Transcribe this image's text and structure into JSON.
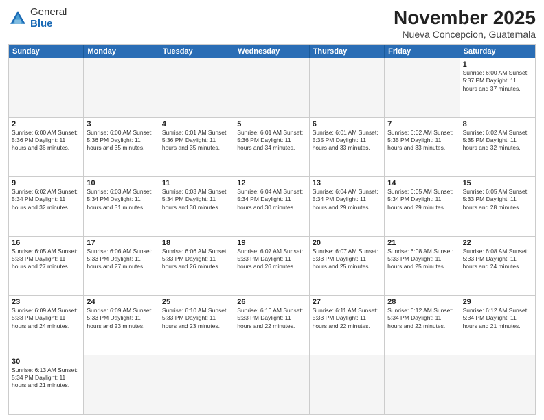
{
  "header": {
    "logo": {
      "general": "General",
      "blue": "Blue"
    },
    "month_year": "November 2025",
    "location": "Nueva Concepcion, Guatemala"
  },
  "weekdays": [
    "Sunday",
    "Monday",
    "Tuesday",
    "Wednesday",
    "Thursday",
    "Friday",
    "Saturday"
  ],
  "weeks": [
    [
      {
        "day": "",
        "info": "",
        "empty": true
      },
      {
        "day": "",
        "info": "",
        "empty": true
      },
      {
        "day": "",
        "info": "",
        "empty": true
      },
      {
        "day": "",
        "info": "",
        "empty": true
      },
      {
        "day": "",
        "info": "",
        "empty": true
      },
      {
        "day": "",
        "info": "",
        "empty": true
      },
      {
        "day": "1",
        "info": "Sunrise: 6:00 AM\nSunset: 5:37 PM\nDaylight: 11 hours\nand 37 minutes.",
        "empty": false
      }
    ],
    [
      {
        "day": "2",
        "info": "Sunrise: 6:00 AM\nSunset: 5:36 PM\nDaylight: 11 hours\nand 36 minutes.",
        "empty": false
      },
      {
        "day": "3",
        "info": "Sunrise: 6:00 AM\nSunset: 5:36 PM\nDaylight: 11 hours\nand 35 minutes.",
        "empty": false
      },
      {
        "day": "4",
        "info": "Sunrise: 6:01 AM\nSunset: 5:36 PM\nDaylight: 11 hours\nand 35 minutes.",
        "empty": false
      },
      {
        "day": "5",
        "info": "Sunrise: 6:01 AM\nSunset: 5:36 PM\nDaylight: 11 hours\nand 34 minutes.",
        "empty": false
      },
      {
        "day": "6",
        "info": "Sunrise: 6:01 AM\nSunset: 5:35 PM\nDaylight: 11 hours\nand 33 minutes.",
        "empty": false
      },
      {
        "day": "7",
        "info": "Sunrise: 6:02 AM\nSunset: 5:35 PM\nDaylight: 11 hours\nand 33 minutes.",
        "empty": false
      },
      {
        "day": "8",
        "info": "Sunrise: 6:02 AM\nSunset: 5:35 PM\nDaylight: 11 hours\nand 32 minutes.",
        "empty": false
      }
    ],
    [
      {
        "day": "9",
        "info": "Sunrise: 6:02 AM\nSunset: 5:34 PM\nDaylight: 11 hours\nand 32 minutes.",
        "empty": false
      },
      {
        "day": "10",
        "info": "Sunrise: 6:03 AM\nSunset: 5:34 PM\nDaylight: 11 hours\nand 31 minutes.",
        "empty": false
      },
      {
        "day": "11",
        "info": "Sunrise: 6:03 AM\nSunset: 5:34 PM\nDaylight: 11 hours\nand 30 minutes.",
        "empty": false
      },
      {
        "day": "12",
        "info": "Sunrise: 6:04 AM\nSunset: 5:34 PM\nDaylight: 11 hours\nand 30 minutes.",
        "empty": false
      },
      {
        "day": "13",
        "info": "Sunrise: 6:04 AM\nSunset: 5:34 PM\nDaylight: 11 hours\nand 29 minutes.",
        "empty": false
      },
      {
        "day": "14",
        "info": "Sunrise: 6:05 AM\nSunset: 5:34 PM\nDaylight: 11 hours\nand 29 minutes.",
        "empty": false
      },
      {
        "day": "15",
        "info": "Sunrise: 6:05 AM\nSunset: 5:33 PM\nDaylight: 11 hours\nand 28 minutes.",
        "empty": false
      }
    ],
    [
      {
        "day": "16",
        "info": "Sunrise: 6:05 AM\nSunset: 5:33 PM\nDaylight: 11 hours\nand 27 minutes.",
        "empty": false
      },
      {
        "day": "17",
        "info": "Sunrise: 6:06 AM\nSunset: 5:33 PM\nDaylight: 11 hours\nand 27 minutes.",
        "empty": false
      },
      {
        "day": "18",
        "info": "Sunrise: 6:06 AM\nSunset: 5:33 PM\nDaylight: 11 hours\nand 26 minutes.",
        "empty": false
      },
      {
        "day": "19",
        "info": "Sunrise: 6:07 AM\nSunset: 5:33 PM\nDaylight: 11 hours\nand 26 minutes.",
        "empty": false
      },
      {
        "day": "20",
        "info": "Sunrise: 6:07 AM\nSunset: 5:33 PM\nDaylight: 11 hours\nand 25 minutes.",
        "empty": false
      },
      {
        "day": "21",
        "info": "Sunrise: 6:08 AM\nSunset: 5:33 PM\nDaylight: 11 hours\nand 25 minutes.",
        "empty": false
      },
      {
        "day": "22",
        "info": "Sunrise: 6:08 AM\nSunset: 5:33 PM\nDaylight: 11 hours\nand 24 minutes.",
        "empty": false
      }
    ],
    [
      {
        "day": "23",
        "info": "Sunrise: 6:09 AM\nSunset: 5:33 PM\nDaylight: 11 hours\nand 24 minutes.",
        "empty": false
      },
      {
        "day": "24",
        "info": "Sunrise: 6:09 AM\nSunset: 5:33 PM\nDaylight: 11 hours\nand 23 minutes.",
        "empty": false
      },
      {
        "day": "25",
        "info": "Sunrise: 6:10 AM\nSunset: 5:33 PM\nDaylight: 11 hours\nand 23 minutes.",
        "empty": false
      },
      {
        "day": "26",
        "info": "Sunrise: 6:10 AM\nSunset: 5:33 PM\nDaylight: 11 hours\nand 22 minutes.",
        "empty": false
      },
      {
        "day": "27",
        "info": "Sunrise: 6:11 AM\nSunset: 5:33 PM\nDaylight: 11 hours\nand 22 minutes.",
        "empty": false
      },
      {
        "day": "28",
        "info": "Sunrise: 6:12 AM\nSunset: 5:34 PM\nDaylight: 11 hours\nand 22 minutes.",
        "empty": false
      },
      {
        "day": "29",
        "info": "Sunrise: 6:12 AM\nSunset: 5:34 PM\nDaylight: 11 hours\nand 21 minutes.",
        "empty": false
      }
    ],
    [
      {
        "day": "30",
        "info": "Sunrise: 6:13 AM\nSunset: 5:34 PM\nDaylight: 11 hours\nand 21 minutes.",
        "empty": false
      },
      {
        "day": "",
        "info": "",
        "empty": true
      },
      {
        "day": "",
        "info": "",
        "empty": true
      },
      {
        "day": "",
        "info": "",
        "empty": true
      },
      {
        "day": "",
        "info": "",
        "empty": true
      },
      {
        "day": "",
        "info": "",
        "empty": true
      },
      {
        "day": "",
        "info": "",
        "empty": true
      }
    ]
  ]
}
